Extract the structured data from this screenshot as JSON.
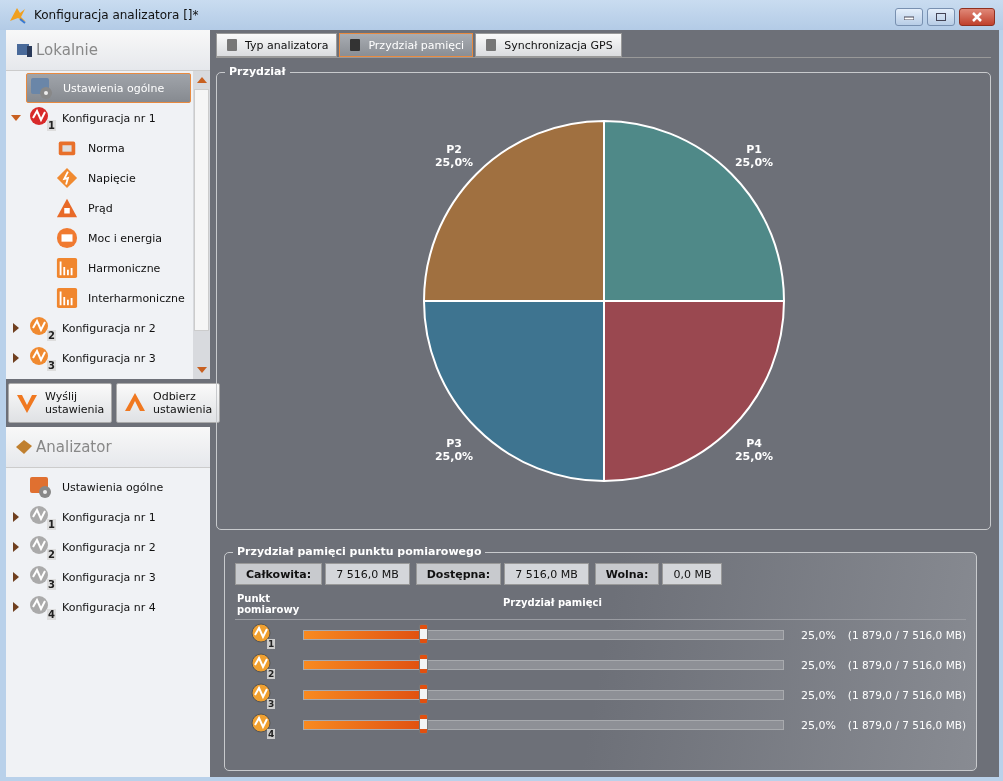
{
  "window": {
    "title": "Konfiguracja analizatora []*"
  },
  "local": {
    "title": "Lokalnie",
    "items": [
      {
        "label": "Ustawienia ogólne",
        "kind": "settings",
        "selected": true
      },
      {
        "label": "Konfiguracja nr 1",
        "kind": "config",
        "badge": "1",
        "active": true,
        "selected": false,
        "expanded": true,
        "children": [
          {
            "label": "Norma",
            "kind": "norm",
            "selected": false
          },
          {
            "label": "Napięcie",
            "kind": "voltage",
            "selected": false
          },
          {
            "label": "Prąd",
            "kind": "current",
            "selected": false
          },
          {
            "label": "Moc i energia",
            "kind": "power",
            "selected": false
          },
          {
            "label": "Harmoniczne",
            "kind": "harmonics",
            "selected": false
          },
          {
            "label": "Interharmoniczne",
            "kind": "harmonics",
            "selected": false
          }
        ]
      },
      {
        "label": "Konfiguracja nr 2",
        "kind": "config",
        "badge": "2",
        "active": true,
        "selected": false,
        "expanded": false
      },
      {
        "label": "Konfiguracja nr 3",
        "kind": "config",
        "badge": "3",
        "active": true,
        "selected": false,
        "expanded": false
      }
    ]
  },
  "actions": [
    {
      "label": "Wyślij ustawienia",
      "kind": "send"
    },
    {
      "label": "Odbierz ustawienia",
      "kind": "receive"
    }
  ],
  "analyzer": {
    "title": "Analizator",
    "items": [
      {
        "label": "Ustawienia ogólne",
        "kind": "settings",
        "selected": false
      },
      {
        "label": "Konfiguracja nr 1",
        "kind": "config",
        "badge": "1",
        "active": false,
        "selected": false,
        "expanded": false
      },
      {
        "label": "Konfiguracja nr 2",
        "kind": "config",
        "badge": "2",
        "active": false,
        "selected": false,
        "expanded": false
      },
      {
        "label": "Konfiguracja nr 3",
        "kind": "config",
        "badge": "3",
        "active": false,
        "selected": false,
        "expanded": false
      },
      {
        "label": "Konfiguracja nr 4",
        "kind": "config",
        "badge": "4",
        "active": false,
        "selected": false,
        "expanded": false
      }
    ]
  },
  "tabs": [
    {
      "label": "Typ analizatora",
      "selected": false
    },
    {
      "label": "Przydział pamięci",
      "selected": true
    },
    {
      "label": "Synchronizacja GPS",
      "selected": false
    }
  ],
  "allocation": {
    "title": "Przydział",
    "chart_data": {
      "type": "pie",
      "categories": [
        "P1",
        "P4",
        "P3",
        "P2"
      ],
      "values": [
        25,
        25,
        25,
        25
      ],
      "value_labels": [
        "25,0%",
        "25,0%",
        "25,0%",
        "25,0%"
      ]
    }
  },
  "memory": {
    "title": "Przydział pamięci punktu pomiarowego",
    "summary": [
      {
        "label": "Całkowita:",
        "value": "7 516,0 MB"
      },
      {
        "label": "Dostępna:",
        "value": "7 516,0 MB"
      },
      {
        "label": "Wolna:",
        "value": "0,0 MB"
      }
    ],
    "columns": [
      "Punkt pomiarowy",
      "Przydział pamięci"
    ],
    "rows": [
      {
        "point": "1",
        "level": 0.25,
        "percent": "25,0%",
        "detail": "(1 879,0 / 7 516,0 MB)"
      },
      {
        "point": "2",
        "level": 0.25,
        "percent": "25,0%",
        "detail": "(1 879,0 / 7 516,0 MB)"
      },
      {
        "point": "3",
        "level": 0.25,
        "percent": "25,0%",
        "detail": "(1 879,0 / 7 516,0 MB)"
      },
      {
        "point": "4",
        "level": 0.25,
        "percent": "25,0%",
        "detail": "(1 879,0 / 7 516,0 MB)"
      }
    ]
  }
}
